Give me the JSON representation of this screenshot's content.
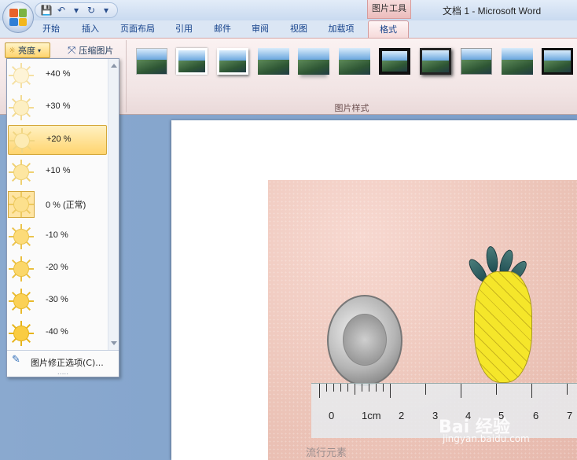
{
  "titlebar": {
    "window_title": "文档 1 - Microsoft Word",
    "context_tab_group": "图片工具",
    "qat_save": "💾",
    "qat_undo": "↶",
    "qat_redo": "↻",
    "qat_more": "▾"
  },
  "tabs": [
    {
      "label": "开始"
    },
    {
      "label": "插入"
    },
    {
      "label": "页面布局"
    },
    {
      "label": "引用"
    },
    {
      "label": "邮件"
    },
    {
      "label": "审阅"
    },
    {
      "label": "视图"
    },
    {
      "label": "加载项"
    },
    {
      "label": "格式"
    }
  ],
  "ribbon": {
    "brightness_button": "亮度",
    "compress_button": "压缩图片",
    "styles_group_label": "图片样式"
  },
  "dropdown": {
    "items": [
      {
        "label": "+40 %"
      },
      {
        "label": "+30 %"
      },
      {
        "label": "+20 %"
      },
      {
        "label": "+10 %"
      },
      {
        "label": "0 % (正常)"
      },
      {
        "label": "-10 %"
      },
      {
        "label": "-20 %"
      },
      {
        "label": "-30 %"
      },
      {
        "label": "-40 %"
      }
    ],
    "hovered_item": "+20 %",
    "selected_item": "0 % (正常)",
    "options_label": "图片修正选项(C)...",
    "grip": "....."
  },
  "photo": {
    "ruler_numbers": [
      "0",
      "1cm",
      "2",
      "3",
      "4",
      "5",
      "6",
      "7"
    ],
    "watermark_left": "流行元素",
    "watermark_brand": "Bai 经验",
    "watermark_url": "jingyan.baidu.com"
  },
  "colors": {
    "accent_context": "#e9b3b3",
    "hover_fill": "#ffd46e"
  }
}
